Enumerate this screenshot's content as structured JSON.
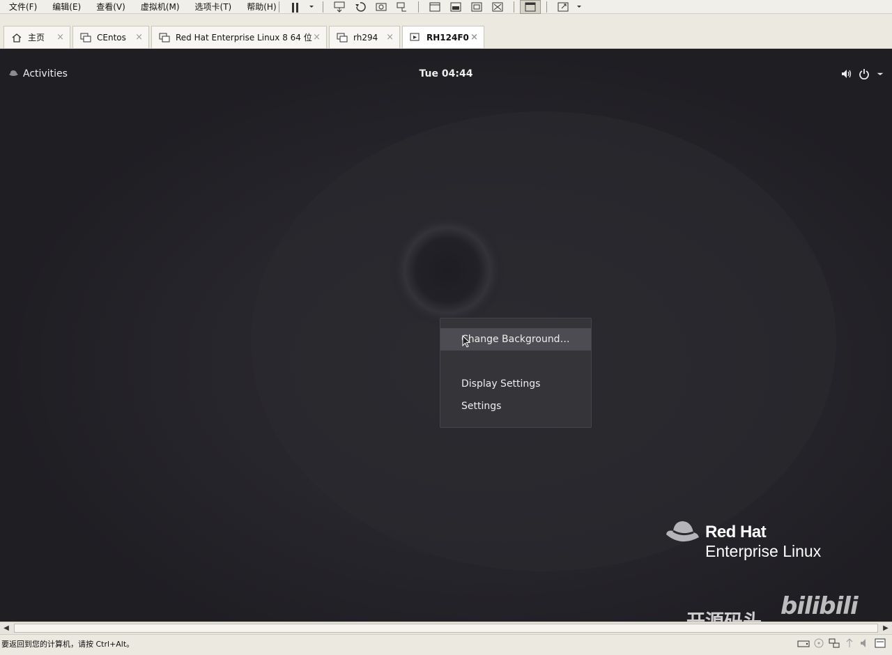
{
  "vmware": {
    "menu": [
      "文件(F)",
      "编辑(E)",
      "查看(V)",
      "虚拟机(M)",
      "选项卡(T)",
      "帮助(H)"
    ],
    "tabs": [
      {
        "label": "主页",
        "icon": "home-icon"
      },
      {
        "label": "CEntos",
        "icon": "vm-icon"
      },
      {
        "label": "Red Hat Enterprise Linux 8 64 位",
        "icon": "vm-icon"
      },
      {
        "label": "rh294",
        "icon": "vm-icon"
      },
      {
        "label": "RH124F0",
        "icon": "vm-running-icon",
        "active": true
      }
    ],
    "tab_close": "×",
    "status_text": "要返回到您的计算机，请按 Ctrl+Alt。"
  },
  "guest": {
    "topbar": {
      "activities": "Activities",
      "clock": "Tue 04:44"
    },
    "context_menu": {
      "items": [
        {
          "label": "Change Background…",
          "hover": true
        },
        {
          "label": "Display Settings"
        },
        {
          "label": "Settings"
        }
      ]
    },
    "branding": {
      "brand": "Red Hat",
      "product": "Enterprise Linux"
    },
    "watermark": {
      "text": "开源码头",
      "logo": "bilibili"
    }
  },
  "colors": {
    "desktop_bg": "#222127",
    "menu_bg": "#353439",
    "menu_hover": "#4d4c52"
  }
}
